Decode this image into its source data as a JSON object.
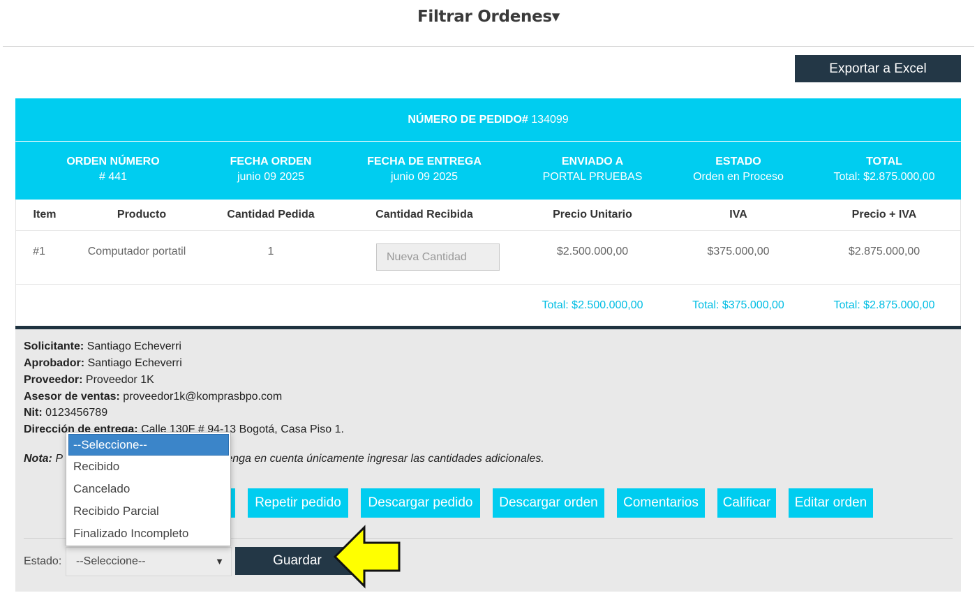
{
  "filter": {
    "title": "Filtrar Ordenes",
    "caret": "▾"
  },
  "export_label": "Exportar a Excel",
  "order": {
    "pedido_label": "NÚMERO DE PEDIDO#",
    "pedido_number": "134099",
    "summary": [
      {
        "heading": "ORDEN NÚMERO",
        "value": "# 441"
      },
      {
        "heading": "FECHA ORDEN",
        "value": "junio 09 2025"
      },
      {
        "heading": "FECHA DE ENTREGA",
        "value": "junio 09 2025"
      },
      {
        "heading": "ENVIADO A",
        "value": "PORTAL PRUEBAS"
      },
      {
        "heading": "ESTADO",
        "value": "Orden en Proceso"
      },
      {
        "heading": "TOTAL",
        "value": "Total: $2.875.000,00"
      }
    ],
    "columns": [
      "Item",
      "Producto",
      "Cantidad Pedida",
      "Cantidad Recibida",
      "Precio Unitario",
      "IVA",
      "Precio + IVA"
    ],
    "row": {
      "item": "#1",
      "producto": "Computador portatil",
      "cantidad_pedida": "1",
      "cantidad_placeholder": "Nueva Cantidad",
      "precio_unitario": "$2.500.000,00",
      "iva": "$375.000,00",
      "precio_iva": "$2.875.000,00"
    },
    "totals": {
      "precio_unitario": "Total: $2.500.000,00",
      "iva": "Total: $375.000,00",
      "precio_iva": "Total: $2.875.000,00"
    }
  },
  "info": {
    "solicitante": {
      "label": "Solicitante:",
      "value": "Santiago Echeverri"
    },
    "aprobador": {
      "label": "Aprobador:",
      "value": "Santiago Echeverri"
    },
    "proveedor": {
      "label": "Proveedor:",
      "value": "Proveedor 1K"
    },
    "asesor": {
      "label": "Asesor de ventas:",
      "value": "proveedor1k@komprasbpo.com"
    },
    "nit": {
      "label": "Nit:",
      "value": "0123456789"
    },
    "direccion": {
      "label": "Dirección de entrega:",
      "value": "Calle 130F # 94-13 Bogotá, Casa Piso 1."
    },
    "nota_label": "Nota:",
    "nota_text": "P",
    "nota_rest": "al tenga en cuenta únicamente ingresar las cantidades adicionales."
  },
  "actions": {
    "repetir": "Repetir pedido",
    "descargar_pedido": "Descargar pedido",
    "descargar_orden": "Descargar orden",
    "comentarios": "Comentarios",
    "calificar": "Calificar",
    "editar": "Editar orden"
  },
  "estado": {
    "label": "Estado:",
    "selected": "--Seleccione--",
    "options": [
      "--Seleccione--",
      "Recibido",
      "Cancelado",
      "Recibido Parcial",
      "Finalizado Incompleto"
    ],
    "save_label": "Guardar"
  },
  "colors": {
    "accent": "#00cdf0",
    "dark": "#233746",
    "highlight_arrow": "#ffff00",
    "dropdown_selected": "#3b85c9"
  }
}
